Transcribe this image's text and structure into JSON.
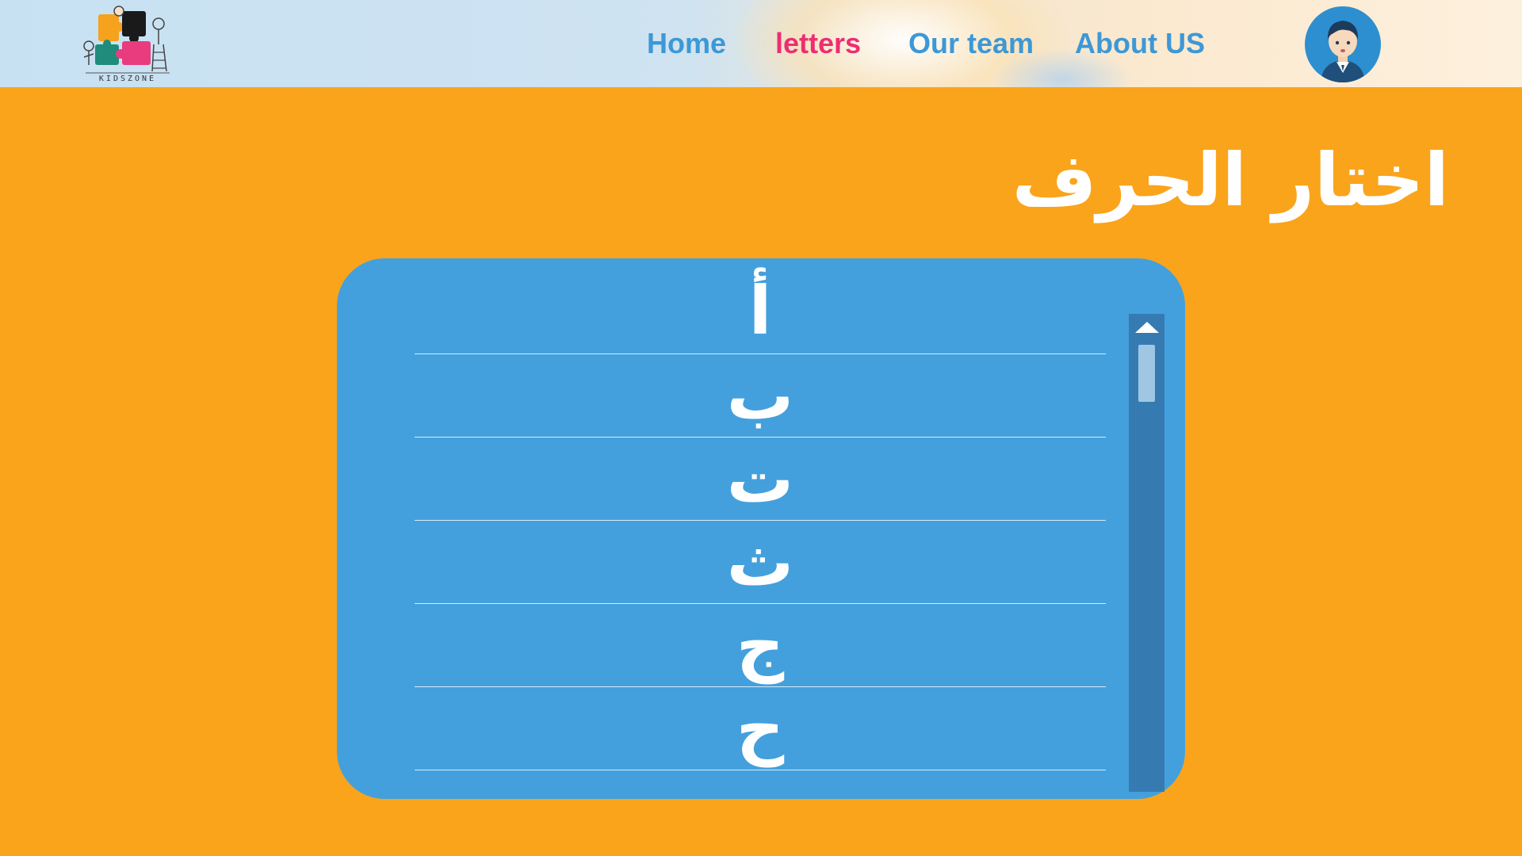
{
  "header": {
    "logo_caption": "KIDSZONE",
    "nav": [
      {
        "label": "Home",
        "active": false
      },
      {
        "label": "letters",
        "active": true
      },
      {
        "label": "Our team",
        "active": false
      },
      {
        "label": "About US",
        "active": false
      }
    ],
    "avatar_icon": "boy-avatar-icon"
  },
  "main": {
    "title": "اختار الحرف",
    "letters": [
      "أ",
      "ب",
      "ت",
      "ث",
      "ج",
      "ح"
    ]
  },
  "colors": {
    "page_background": "#faa41b",
    "panel_background": "#43a0dd",
    "nav_link": "#3d98d6",
    "nav_active": "#ee2d72",
    "scrollbar_track": "#357bb1",
    "scrollbar_thumb": "#9fc6e3"
  }
}
